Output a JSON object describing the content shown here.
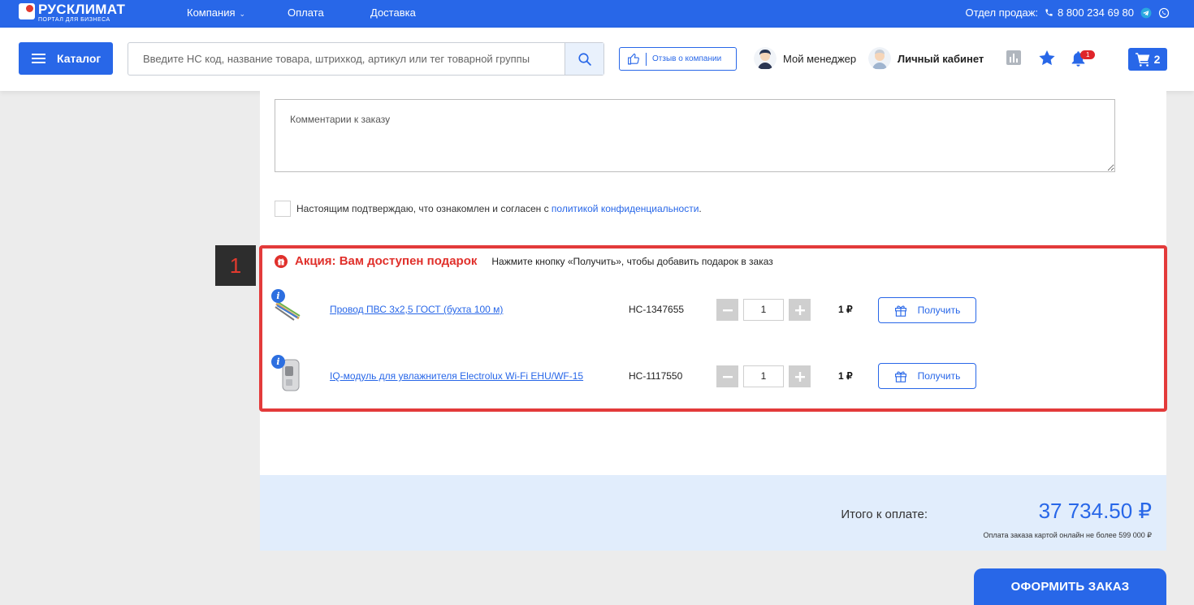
{
  "brand": {
    "name": "РУСКЛИМАТ",
    "tagline": "ПОРТАЛ ДЛЯ БИЗНЕСА"
  },
  "topnav": {
    "company": "Компания",
    "payment": "Оплата",
    "delivery": "Доставка"
  },
  "sales": {
    "label": "Отдел продаж:",
    "phone": "8 800 234 69 80"
  },
  "header": {
    "catalog_label": "Каталог",
    "search_placeholder": "Введите НС код, название товара, штрихкод, артикул или тег товарной группы",
    "review_label": "Отзыв о компании",
    "manager_label": "Мой менеджер",
    "account_label": "Личный кабинет",
    "notifications_count": "1",
    "cart_count": "2"
  },
  "order": {
    "comment_placeholder": "Комментарии к заказу",
    "consent_text": "Настоящим подтверждаю, что ознакомлен и согласен с ",
    "consent_link": "политикой конфиденциальности",
    "consent_end": "."
  },
  "marker": "1",
  "promo": {
    "title": "Акция: Вам доступен подарок",
    "hint": "Нажмите кнопку «Получить», чтобы добавить подарок в заказ",
    "items": [
      {
        "name": "Провод ПВС 3х2,5 ГОСТ (бухта 100 м)",
        "code": "НС-1347655",
        "qty": "1",
        "price": "1 ₽",
        "button": "Получить"
      },
      {
        "name": "IQ-модуль для увлажнителя Electrolux Wi-Fi EHU/WF-15",
        "code": "НС-1117550",
        "qty": "1",
        "price": "1 ₽",
        "button": "Получить"
      }
    ]
  },
  "total": {
    "label": "Итого к оплате:",
    "sum": "37 734.50 ₽",
    "note": "Оплата заказа картой онлайн не более 599 000 ₽"
  },
  "checkout_label": "ОФОРМИТЬ ЗАКАЗ",
  "colors": {
    "brand_blue": "#2867e8",
    "promo_red": "#e0302b",
    "total_bg": "#e1edfc"
  }
}
